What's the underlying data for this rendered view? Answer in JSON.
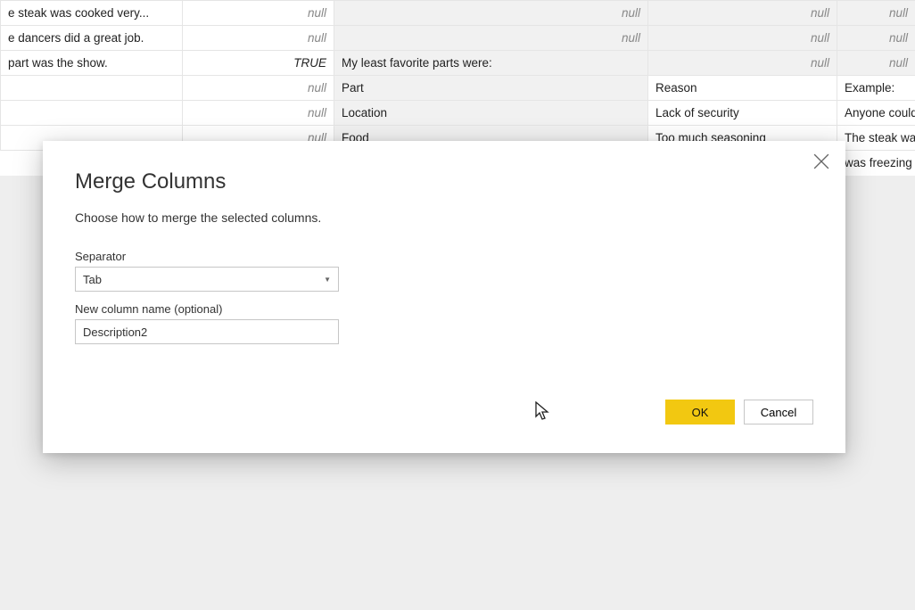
{
  "table": {
    "rows": [
      {
        "c0": "e steak was cooked very...",
        "c1_null": "null",
        "c2_null": "null",
        "c3_null": "null",
        "c4_null": "null"
      },
      {
        "c0": "e dancers did a great job.",
        "c1_null": "null",
        "c2_null": "null",
        "c3_null": "null",
        "c4_null": "null"
      },
      {
        "c0": " part was the show.",
        "c1_true": "TRUE",
        "c2": "My least favorite parts were:",
        "c3_null": "null",
        "c4_null": "null"
      },
      {
        "c0": "",
        "c1_null": "null",
        "c2": "Part",
        "c3": "Reason",
        "c4": "Example:"
      },
      {
        "c0": "",
        "c1_null": "null",
        "c2": "Location",
        "c3": "Lack of security",
        "c4": "Anyone could"
      },
      {
        "c0": "",
        "c1_null": "null",
        "c2": "Food",
        "c3": "Too much seasoning",
        "c4": "The steak wa"
      },
      {
        "c0": "",
        "c1": "",
        "c2": "",
        "c3": "",
        "c4": "was freezing"
      }
    ]
  },
  "dialog": {
    "title": "Merge Columns",
    "subtitle": "Choose how to merge the selected columns.",
    "separator_label": "Separator",
    "separator_value": "Tab",
    "new_name_label": "New column name (optional)",
    "new_name_value": "Description2",
    "ok": "OK",
    "cancel": "Cancel"
  }
}
